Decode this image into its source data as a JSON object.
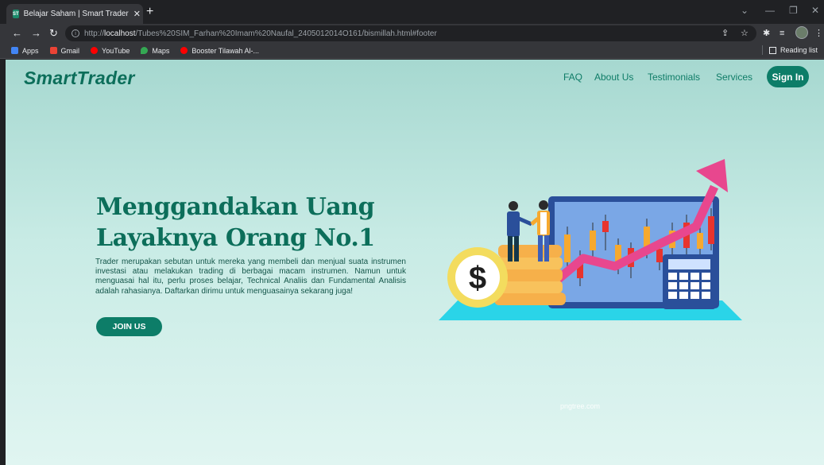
{
  "browser": {
    "tab_title": "Belajar Saham | Smart Trader",
    "favicon_text": "ST",
    "url_prefix": "http://",
    "url_host": "localhost",
    "url_path": "/Tubes%20SIM_Farhan%20Imam%20Naufal_2405012014O161/bismillah.html#footer",
    "bookmarks": [
      {
        "label": "Apps",
        "color": "#4285f4"
      },
      {
        "label": "Gmail",
        "color": "#ea4335"
      },
      {
        "label": "YouTube",
        "color": "#ff0000"
      },
      {
        "label": "Maps",
        "color": "#34a853"
      },
      {
        "label": "Booster Tilawah Al-...",
        "color": "#ff0000"
      }
    ],
    "reading_list": "Reading list"
  },
  "site": {
    "brand": "SmartTrader",
    "nav": [
      "FAQ",
      "About Us",
      "Testimonials",
      "Services"
    ],
    "signin": "Sign In"
  },
  "hero": {
    "headline_line1": "Menggandakan Uang",
    "headline_line2": "Layaknya Orang No.1",
    "description": "Trader merupakan sebutan untuk mereka yang membeli dan menjual suata instrumen investasi atau melakukan trading di berbagai macam instrumen. Namun untuk menguasai hal itu, perlu proses belajar, Technical Analiis dan Fundamental Analisis adalah rahasianya. Daftarkan dirimu untuk menguasainya sekarang juga!",
    "cta": "JOIN US",
    "watermark": "pngtree.com"
  },
  "illustration": {
    "coin_symbol": "$"
  },
  "colors": {
    "brand": "#0c6e5a",
    "button": "#0d7d68",
    "arrow": "#e8478e",
    "monitor": "#2a4f9a",
    "base": "#2ad4e8"
  }
}
